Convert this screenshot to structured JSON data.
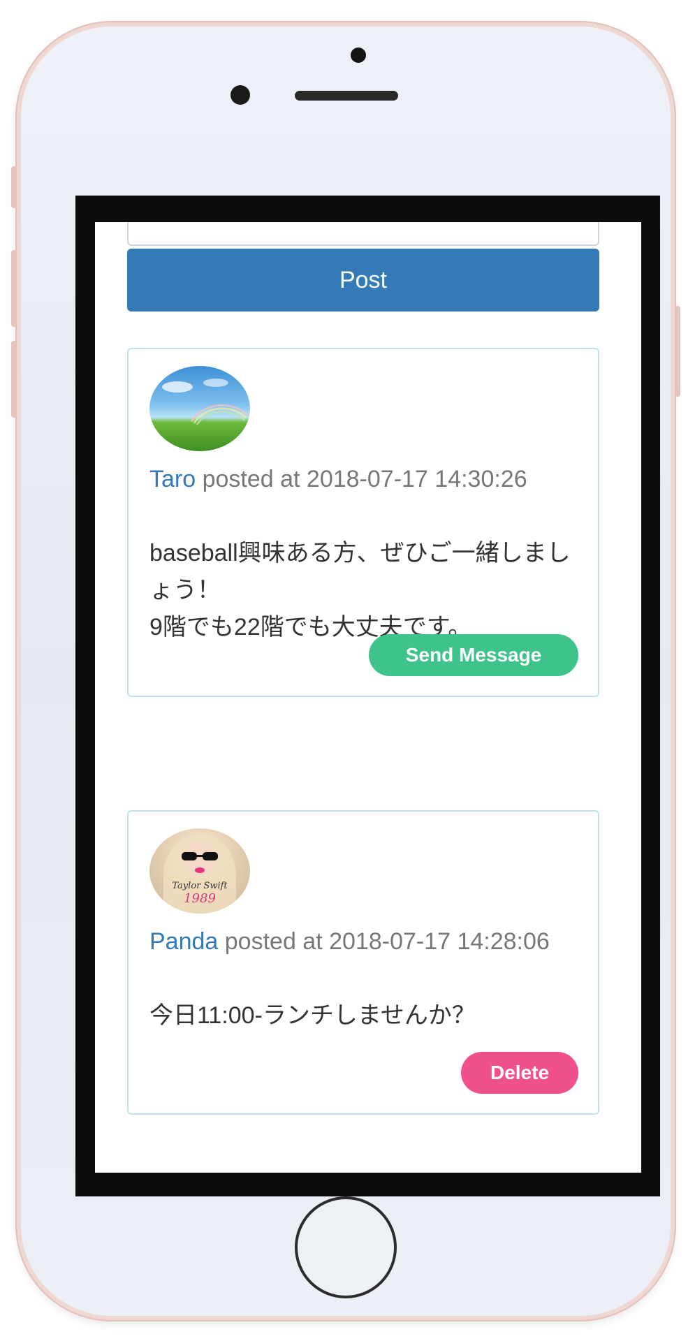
{
  "post_form": {
    "button_label": "Post"
  },
  "posts": [
    {
      "user": "Taro",
      "posted_at_text": " posted at 2018-07-17 14:30:26",
      "lines": [
        "baseball興味ある方、ぜひご一緒しましょう！",
        "9階でも22階でも大丈夫です。"
      ],
      "action_label": "Send Message"
    },
    {
      "user": "Panda",
      "posted_at_text": " posted at 2018-07-17 14:28:06",
      "lines": [
        "今日11:00-ランチしませんか？"
      ],
      "action_label": "Delete",
      "avatar_text_line1": "Taylor Swift",
      "avatar_text_line2": "1989"
    }
  ],
  "colors": {
    "primary": "#337ab7",
    "success": "#3ec38a",
    "danger": "#f0518a",
    "card_border": "#bfe4ea"
  }
}
